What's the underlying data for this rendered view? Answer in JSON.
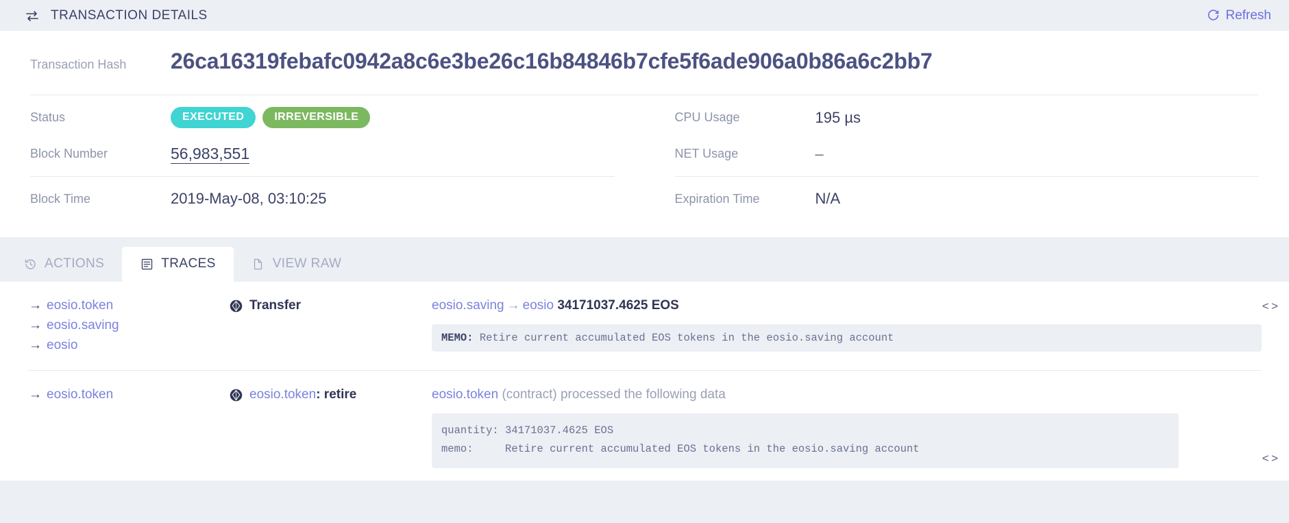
{
  "topbar": {
    "icon": "transfer-arrows-icon",
    "title": "TRANSACTION DETAILS",
    "refresh_label": "Refresh",
    "refresh_icon": "refresh-icon"
  },
  "summary": {
    "hash_label": "Transaction Hash",
    "hash_value": "26ca16319febafc0942a8c6e3be26c16b84846b7cfe5f6ade906a0b86a6c2bb7",
    "status_label": "Status",
    "status_badges": [
      {
        "text": "EXECUTED",
        "color": "#40d4d2"
      },
      {
        "text": "IRREVERSIBLE",
        "color": "#7cb860"
      }
    ],
    "block_number_label": "Block Number",
    "block_number_value": "56,983,551",
    "block_time_label": "Block Time",
    "block_time_value": "2019-May-08, 03:10:25",
    "cpu_label": "CPU Usage",
    "cpu_value": "195 µs",
    "net_label": "NET Usage",
    "net_value": "–",
    "expiration_label": "Expiration Time",
    "expiration_value": "N/A"
  },
  "tabs": [
    {
      "label": "ACTIONS",
      "icon": "history-clock-icon",
      "active": false
    },
    {
      "label": "TRACES",
      "icon": "list-lines-icon",
      "active": true
    },
    {
      "label": "VIEW RAW",
      "icon": "document-icon",
      "active": false
    }
  ],
  "traces": [
    {
      "accounts": [
        "eosio.token",
        "eosio.saving",
        "eosio"
      ],
      "action_icon": "eos-logo-icon",
      "action_contract": "",
      "action_name": "Transfer",
      "from": "eosio.saving",
      "to": "eosio",
      "amount": "34171037.4625 EOS",
      "memo_key": "MEMO:",
      "memo_value": "Retire current accumulated EOS tokens in the eosio.saving account",
      "code_toggle_icon": "code-brackets-icon"
    },
    {
      "accounts": [
        "eosio.token"
      ],
      "action_icon": "eos-logo-icon",
      "action_contract": "eosio.token",
      "action_name": "retire",
      "head_link": "eosio.token",
      "head_rest": "(contract) processed the following data",
      "data_lines": [
        "quantity: 34171037.4625 EOS",
        "memo:     Retire current accumulated EOS tokens in the eosio.saving account"
      ],
      "code_toggle_icon": "code-brackets-icon"
    }
  ]
}
